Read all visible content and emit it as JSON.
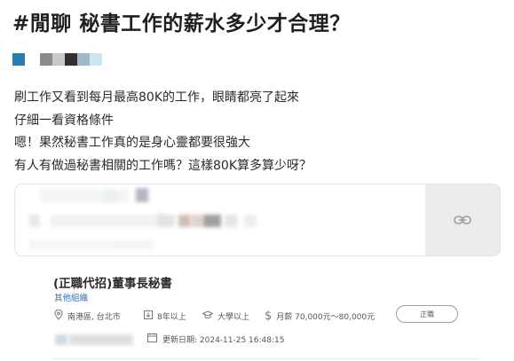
{
  "post": {
    "title": "#閒聊 秘書工作的薪水多少才合理？",
    "body_lines": [
      "刷工作又看到每月最高80K的工作，眼睛都亮了起來",
      "仔細一看資格條件",
      "嗯！果然秘書工作真的是身心靈都要很強大",
      "有人有做過秘書相關的工作嗎？這樣80K算多算少呀？"
    ]
  },
  "link_card": {
    "icon": "link-icon"
  },
  "job": {
    "title": "(正職代招)董事長秘書",
    "company": "其他組織",
    "location": "南港區, 台北市",
    "experience": "8年以上",
    "education": "大學以上",
    "salary": "月薪 70,000元～80,000元",
    "apply_label": "正職",
    "updated": "更新日期: 2024-11-25 16:48:15"
  },
  "colors": {
    "accent_blue": "#2a7bb0",
    "link_blue": "#3a6fb5",
    "card_side": "#ececec"
  }
}
